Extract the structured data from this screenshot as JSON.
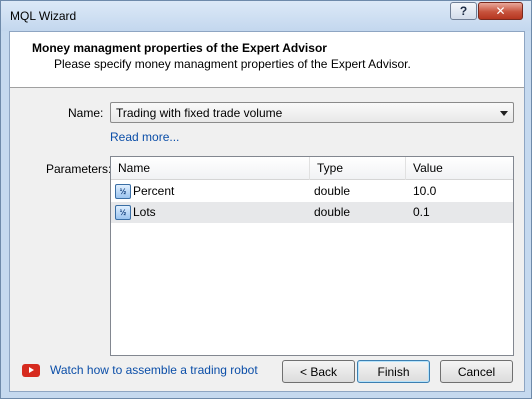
{
  "window": {
    "title": "MQL Wizard",
    "help_label": "?",
    "close_label": "✕"
  },
  "header": {
    "title": "Money managment properties of the Expert Advisor",
    "subtitle": "Please specify money managment properties of the Expert Advisor."
  },
  "form": {
    "name_label": "Name:",
    "name_value": "Trading with fixed trade volume",
    "read_more": "Read more...",
    "parameters_label": "Parameters:"
  },
  "table": {
    "columns": [
      "Name",
      "Type",
      "Value"
    ],
    "rows": [
      {
        "icon": "½",
        "name": "Percent",
        "type": "double",
        "value": "10.0"
      },
      {
        "icon": "½",
        "name": "Lots",
        "type": "double",
        "value": "0.1"
      }
    ]
  },
  "footer": {
    "video_link": "Watch how to assemble a trading robot",
    "back_label": "< Back",
    "finish_label": "Finish",
    "cancel_label": "Cancel"
  },
  "colors": {
    "link": "#0b4ea8",
    "youtube_red": "#d62b1f",
    "selected_row": "#e7e8ea"
  }
}
